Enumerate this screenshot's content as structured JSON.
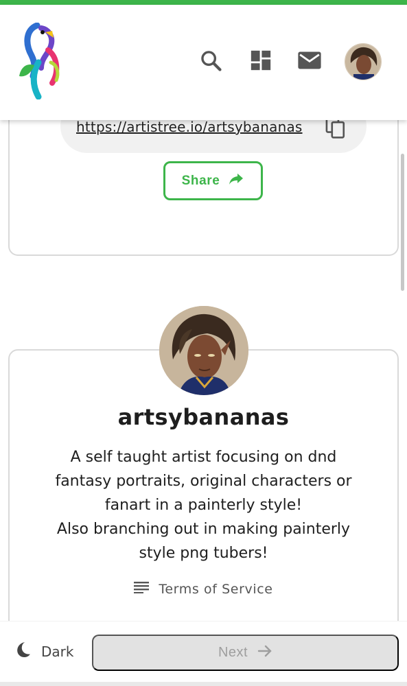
{
  "colors": {
    "accent": "#3db54a",
    "text": "#1e1e1e",
    "muted": "#9e9e9e"
  },
  "header": {
    "logo": "parrot-logo",
    "icons": [
      "search-icon",
      "dashboard-icon",
      "mail-icon",
      "avatar"
    ]
  },
  "share_card": {
    "url": "https://artistree.io/artsybananas",
    "share_label": "Share"
  },
  "profile": {
    "username": "artsybananas",
    "bio_lines": [
      "A self taught artist focusing on dnd",
      "fantasy portraits, original characters or",
      "fanart in a painterly style!",
      "Also branching out in making painterly",
      "style png tubers!"
    ],
    "tos_label": "Terms of Service"
  },
  "footer": {
    "dark_label": "Dark",
    "next_label": "Next"
  }
}
